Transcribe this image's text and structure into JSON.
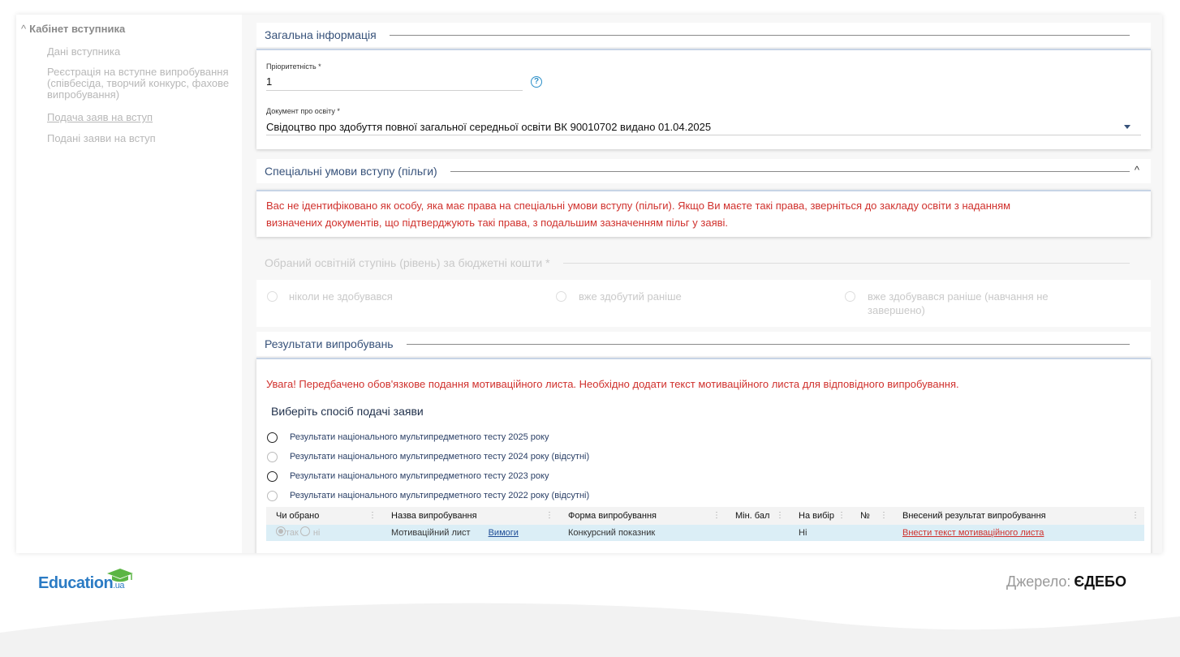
{
  "sidebar": {
    "heading": "Кабінет вступника",
    "items": [
      {
        "label": "Дані вступника"
      },
      {
        "label": "Реєстрація на вступне випробування (співбесіда, творчий конкурс, фахове випробування)"
      },
      {
        "label": "Подача заяв на вступ"
      },
      {
        "label": "Подані заяви на вступ"
      }
    ]
  },
  "general": {
    "title": "Загальна інформація",
    "priority_label": "Пріоритетність *",
    "priority_value": "1",
    "doc_label": "Документ про освіту *",
    "doc_value": "Свідоцтво про здобуття повної загальної середньої освіти ВК 90010702 видано 01.04.2025"
  },
  "special": {
    "title": "Спеціальні умови вступу (пільги)",
    "warning_line1": "Вас не ідентифіковано як особу, яка має права на спеціальні умови вступу (пільги). Якщо Ви маєте такі права, зверніться до закладу освіти з наданням",
    "warning_line2": "визначених документів, що підтверджують такі права, з подальшим зазначенням пільг у заяві."
  },
  "degree": {
    "title": "Обраний освітній ступінь (рівень) за бюджетні кошти *",
    "options": [
      {
        "label": "ніколи не здобувався"
      },
      {
        "label": "вже здобутий раніше"
      },
      {
        "label": "вже здобувався раніше (навчання не завершено)"
      }
    ]
  },
  "results": {
    "title": "Результати випробувань",
    "warning": "Увага! Передбачено обов'язкове подання мотиваційного листа. Необхідно додати текст мотиваційного листа для відповідного випробування.",
    "method_title": "Виберіть спосіб подачі заяви",
    "methods": [
      {
        "label": "Результати національного мультипредметного тесту 2025 року"
      },
      {
        "label": "Результати національного мультипредметного тесту 2024 року (відсутні)"
      },
      {
        "label": "Результати національного мультипредметного тесту 2023 року"
      },
      {
        "label": "Результати національного мультипредметного тесту 2022 року (відсутні)"
      }
    ],
    "table": {
      "headers": [
        "Чи обрано",
        "Назва випробування",
        "Форма випробування",
        "Мін. бал",
        "На вибір",
        "№",
        "Внесений результат випробування"
      ],
      "row": {
        "yes": "так",
        "no": "ні",
        "name": "Мотиваційний лист",
        "requirements_link": "Вимоги",
        "form": "Конкурсний показник",
        "min_score": "",
        "optional": "Ні",
        "number": "",
        "result_link": "Внести текст мотиваційного листа"
      }
    }
  },
  "footer": {
    "logo_text": "Education",
    "logo_suffix": ".ua",
    "source_label": "Джерело:",
    "source_value": "ЄДЕБО"
  },
  "colors": {
    "accent_blue": "#37527a",
    "warning_red": "#d0312d",
    "logo_blue": "#2b7bc4",
    "logo_green": "#5bb544",
    "selected_row": "#dbeef6"
  }
}
